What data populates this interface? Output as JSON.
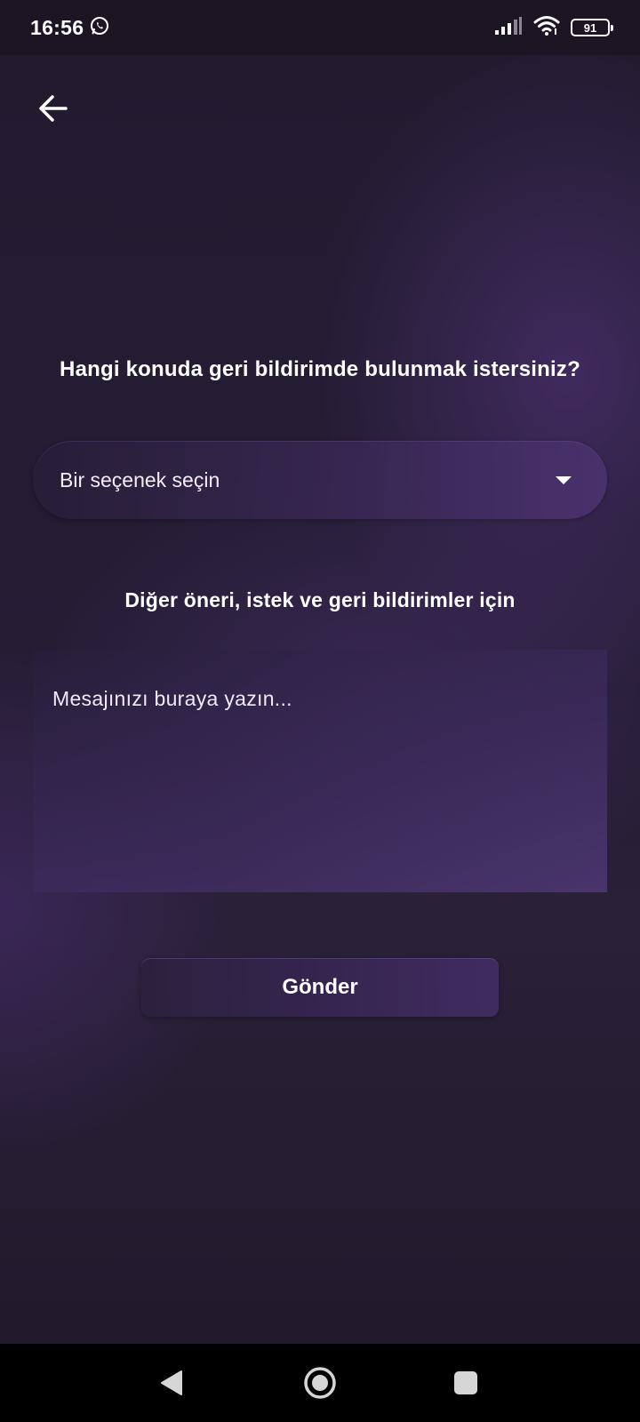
{
  "status_bar": {
    "time": "16:56",
    "notification_icon": "whatsapp-icon",
    "battery_level": "91"
  },
  "header": {
    "back_icon": "arrow-left-icon"
  },
  "form": {
    "question": "Hangi konuda geri bildirimde bulunmak istersiniz?",
    "dropdown_value": "Bir seçenek seçin",
    "subheading": "Diğer öneri, istek ve geri bildirimler için",
    "message_placeholder": "Mesajınızı buraya yazın...",
    "submit_label": "Gönder"
  },
  "nav_bar": {
    "buttons": [
      "back-triangle-icon",
      "home-circle-icon",
      "recents-square-icon"
    ]
  },
  "colors": {
    "background": "#221b30",
    "accent": "#4a3270",
    "text": "#ffffff"
  }
}
